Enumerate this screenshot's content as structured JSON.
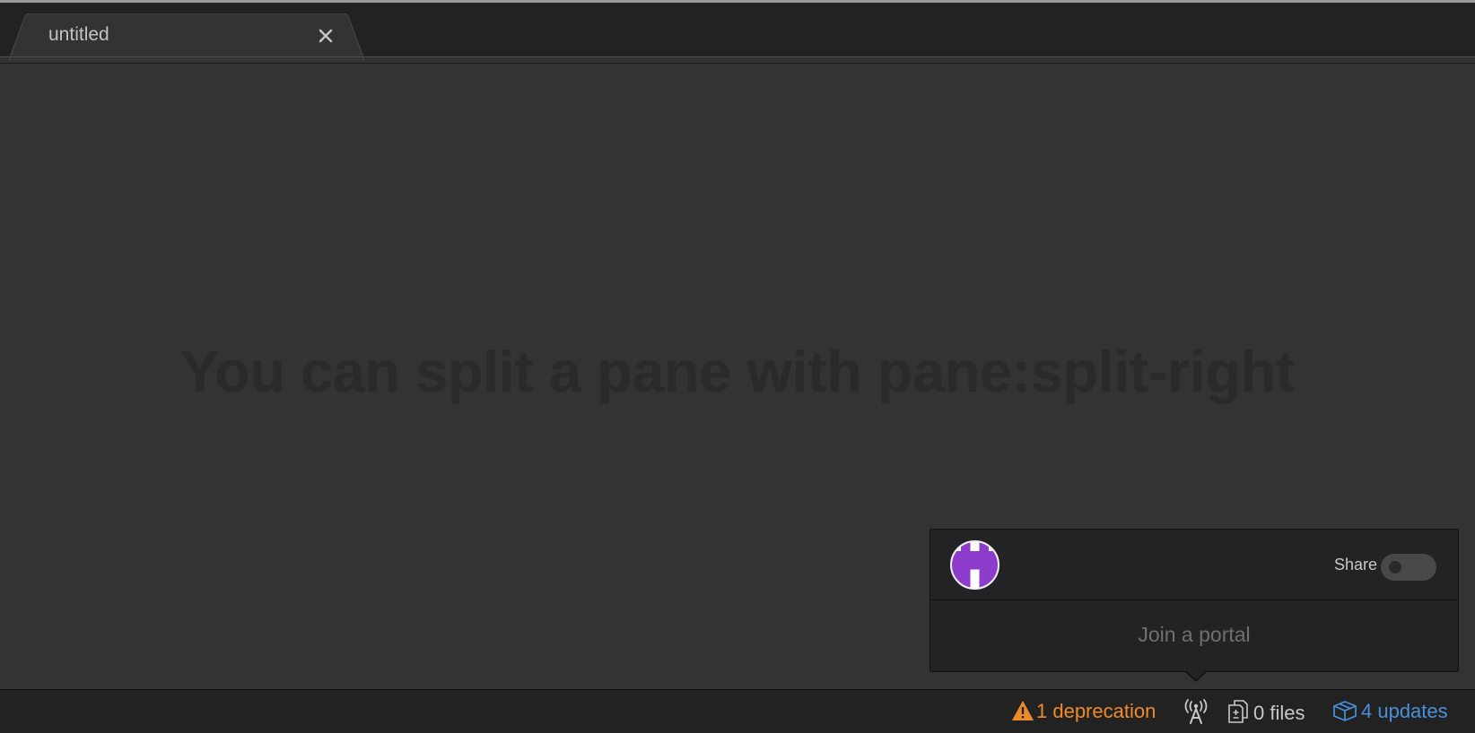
{
  "tabs": [
    {
      "title": "untitled",
      "close_icon": "close-icon"
    }
  ],
  "editor": {
    "hint": "You can split a pane with pane:split-right"
  },
  "teletype_popover": {
    "share_label": "Share",
    "share_enabled": false,
    "join_portal_label": "Join a portal",
    "avatar_icon": "identicon-avatar",
    "avatar_color": "#8e3ccb"
  },
  "status_bar": {
    "deprecation_label": "1 deprecation",
    "deprecation_icon": "warning-icon",
    "deprecation_color": "#ee8c2a",
    "teletype_icon": "broadcast-antenna-icon",
    "files_label": "0 files",
    "files_icon": "file-diff-icon",
    "updates_label": "4 updates",
    "updates_icon": "package-icon",
    "updates_color": "#4a90d9"
  }
}
